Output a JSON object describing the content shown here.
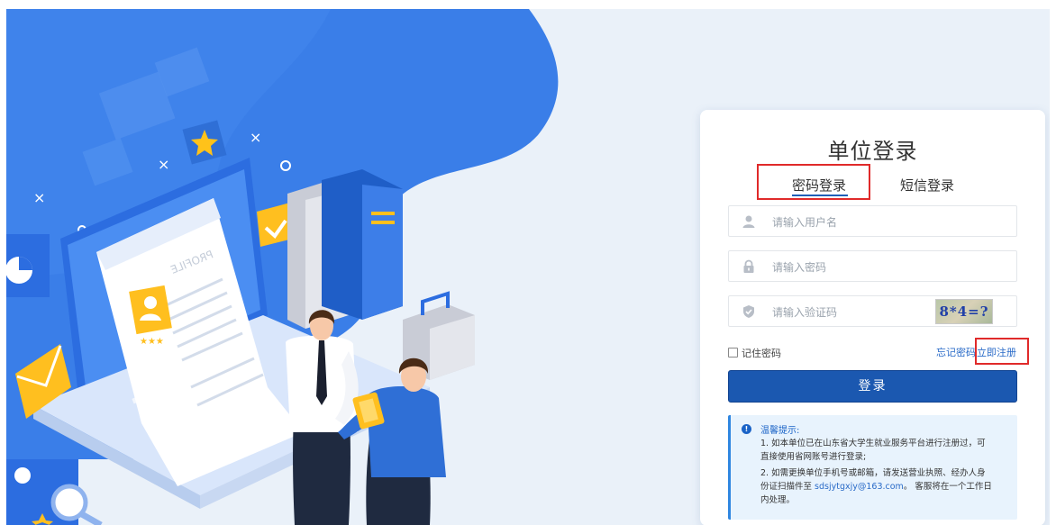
{
  "login": {
    "title": "单位登录",
    "tabs": [
      {
        "label": "密码登录",
        "active": true
      },
      {
        "label": "短信登录",
        "active": false
      }
    ],
    "username_placeholder": "请输入用户名",
    "password_placeholder": "请输入密码",
    "captcha_placeholder": "请输入验证码",
    "captcha_text": "8*4=?",
    "remember_label": "记住密码",
    "forgot_link": "忘记密码",
    "register_link": "立即注册",
    "submit_label": "登录"
  },
  "notice": {
    "title": "温馨提示:",
    "line1a": "1. 如本单位已在山东省大学生就业服务平台进行注册过，可",
    "line1b": "直接使用省网账号进行登录;",
    "line2a": "2. 如需更换单位手机号或邮箱，请发送营业执照、经办人身",
    "line2b_pre": "份证扫描件至 ",
    "email": "sdsjytgxjy@163.com",
    "line2b_post": "。 客服将在一个工作日",
    "line2c": "内处理。"
  },
  "illustration": {
    "profile_text": "PROFILE",
    "icons": [
      "pie-chart-icon",
      "envelope-icon",
      "checkmark-icon",
      "star-icon",
      "search-icon",
      "briefcase-icon",
      "books-icon",
      "laptop-icon"
    ]
  },
  "colors": {
    "brand_blue": "#1b58b0",
    "blob_blue": "#3a7ee8",
    "highlight_red": "#e02a2a",
    "notice_bg": "#e8f3fd",
    "page_bg": "#eaf1f9"
  }
}
